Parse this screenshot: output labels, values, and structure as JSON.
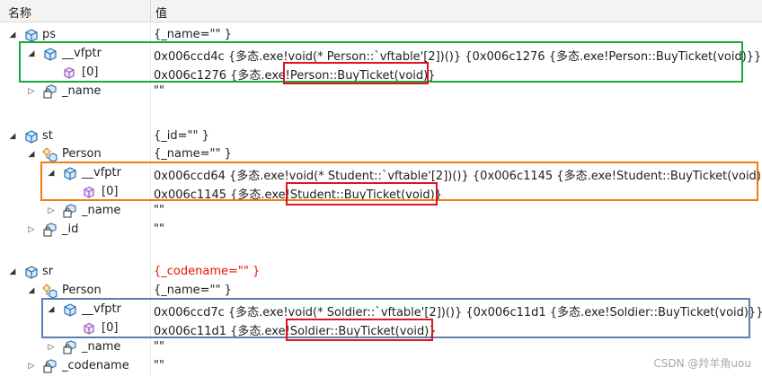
{
  "header": {
    "name_col": "名称",
    "value_col": "值"
  },
  "groups": {
    "ps": {
      "name": "ps",
      "value": "{_name=\"\" }",
      "vfptr": {
        "name": "__vfptr",
        "value": "0x006ccd4c {多态.exe!void(* Person::`vftable'[2])()} {0x006c1276 {多态.exe!Person::BuyTicket(void)}}",
        "item": {
          "name": "[0]",
          "value_prefix": "0x006c1276 {多态.exe!",
          "value_fn": "Person::BuyTicket(void)",
          "value_suffix": "}"
        }
      },
      "field": {
        "name": "_name",
        "value": "\"\""
      }
    },
    "st": {
      "name": "st",
      "value": "{_id=\"\" }",
      "base": {
        "name": "Person",
        "value": "{_name=\"\" }"
      },
      "vfptr": {
        "name": "__vfptr",
        "value": "0x006ccd64 {多态.exe!void(* Student::`vftable'[2])()} {0x006c1145 {多态.exe!Student::BuyTicket(void)}}",
        "item": {
          "name": "[0]",
          "value_prefix": "0x006c1145 {多态.exe!",
          "value_fn": "Student::BuyTicket(void)",
          "value_suffix": "}"
        }
      },
      "base_field": {
        "name": "_name",
        "value": "\"\""
      },
      "field": {
        "name": "_id",
        "value": "\"\""
      }
    },
    "sr": {
      "name": "sr",
      "value": "{_codename=\"\" }",
      "base": {
        "name": "Person",
        "value": "{_name=\"\" }"
      },
      "vfptr": {
        "name": "__vfptr",
        "value": "0x006ccd7c {多态.exe!void(* Soldier::`vftable'[2])()} {0x006c11d1 {多态.exe!Soldier::BuyTicket(void)}}",
        "item": {
          "name": "[0]",
          "value_prefix": "0x006c11d1 {多态.exe!",
          "value_fn": "Soldier::BuyTicket(void)",
          "value_suffix": "}"
        }
      },
      "base_field": {
        "name": "_name",
        "value": "\"\""
      },
      "field": {
        "name": "_codename",
        "value": "\"\""
      }
    }
  },
  "watermark": "CSDN @羚羊角uou",
  "colors": {
    "green_box": "#1aa83a",
    "orange_box": "#f07d10",
    "blue_box": "#5b7fae",
    "red_box": "#e0141e",
    "changed_value": "#e51400"
  }
}
